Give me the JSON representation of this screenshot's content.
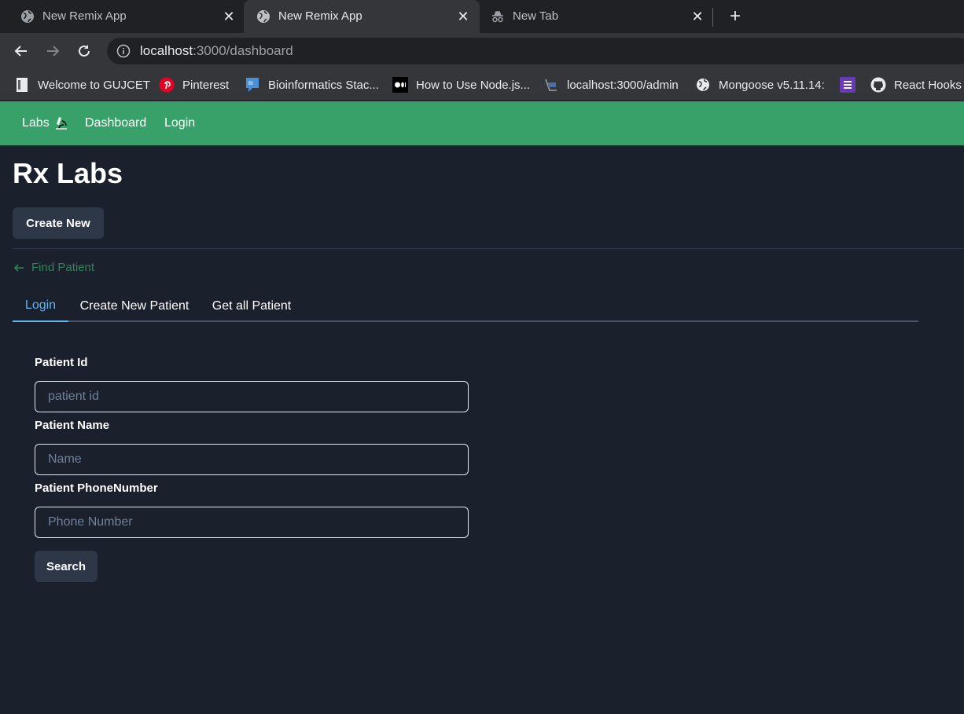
{
  "browser": {
    "tabs": [
      {
        "title": "New Remix App",
        "active": false,
        "icon": "globe-icon"
      },
      {
        "title": "New Remix App",
        "active": true,
        "icon": "globe-icon"
      },
      {
        "title": "New Tab",
        "active": false,
        "icon": "incognito-icon"
      }
    ],
    "new_tab_label": "+",
    "close_glyph": "✕",
    "url_host": "localhost",
    "url_path": ":3000/dashboard",
    "bookmarks": [
      {
        "label": "Welcome to GUJCET",
        "icon": "page-icon"
      },
      {
        "label": "Pinterest",
        "icon": "pinterest-icon"
      },
      {
        "label": "Bioinformatics Stac...",
        "icon": "stackexchange-icon"
      },
      {
        "label": "How to Use Node.js...",
        "icon": "medium-icon"
      },
      {
        "label": "localhost:3000/admin",
        "icon": "page-icon"
      },
      {
        "label": "Mongoose v5.11.14:",
        "icon": "globe-icon"
      },
      {
        "label": "",
        "icon": "list-icon"
      },
      {
        "label": "React Hooks -",
        "icon": "github-icon"
      }
    ]
  },
  "navbar": {
    "brand": "Labs",
    "brand_icon": "microscope-icon",
    "links": [
      "Dashboard",
      "Login"
    ],
    "color": "#38a169"
  },
  "main": {
    "title": "Rx Labs",
    "create_button": "Create New",
    "back_link": "Find Patient",
    "tabs": [
      "Login",
      "Create New Patient",
      "Get all Patient"
    ],
    "selected_tab": "Login",
    "form": {
      "patient_id_label": "Patient Id",
      "patient_id_placeholder": "patient id",
      "patient_name_label": "Patient Name",
      "patient_name_placeholder": "Name",
      "patient_phone_label": "Patient PhoneNumber",
      "patient_phone_placeholder": "Phone Number",
      "search_button": "Search"
    }
  },
  "colors": {
    "background": "#1a202c",
    "accent_tab": "#63b3ed",
    "back_link": "#2f855a",
    "button_bg": "#2d3748"
  }
}
